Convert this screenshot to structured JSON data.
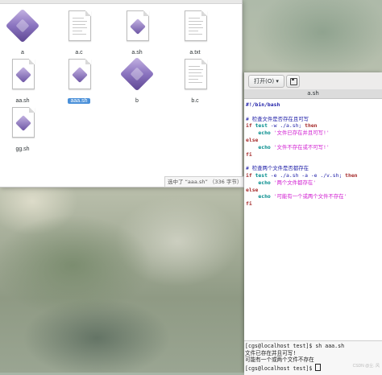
{
  "file_manager": {
    "files": [
      {
        "name": "a",
        "type": "executable"
      },
      {
        "name": "a.c",
        "type": "text"
      },
      {
        "name": "a.sh",
        "type": "script"
      },
      {
        "name": "a.txt",
        "type": "text"
      },
      {
        "name": "aa.sh",
        "type": "script"
      },
      {
        "name": "aaa.sh",
        "type": "script",
        "selected": true
      },
      {
        "name": "b",
        "type": "executable"
      },
      {
        "name": "b.c",
        "type": "text"
      },
      {
        "name": "gg.sh",
        "type": "script"
      }
    ],
    "status_text": "选中了 “aaa.sh” （336 字节）"
  },
  "editor": {
    "open_button_label": "打开(O) ▾",
    "save_icon": "save-icon",
    "tab_title": "a.sh",
    "code": {
      "l1": "#!/bin/bash",
      "l3": "# 检查文件是否存在且可写",
      "l4_kw": "if",
      "l4_cmd": "test",
      "l4_rest": " -w ./a.sh; ",
      "l4_then": "then",
      "l5_echo": "echo",
      "l5_str": "'文件已存在并且可写!'",
      "l6": "else",
      "l7_echo": "echo",
      "l7_str": "'文件不存在或不可写!'",
      "l8": "fi",
      "l10": "# 检查两个文件是否都存在",
      "l11_kw": "if",
      "l11_cmd": "test",
      "l11_rest": " -e ./a.sh -a -e ./v.sh; ",
      "l11_then": "then",
      "l12_echo": "echo",
      "l12_str": "'两个文件都存在'",
      "l13": "else",
      "l14_echo": "echo",
      "l14_str": "'可能有一个或两个文件不存在'",
      "l15": "fi"
    }
  },
  "terminal": {
    "line1": "[cgs@localhost test]$ sh aaa.sh",
    "line2": "文件已存在并且可写!",
    "line3": "可能有一个或两个文件不存在",
    "prompt": "[cgs@localhost test]$ "
  },
  "watermark": "CSDN @尘. 风"
}
